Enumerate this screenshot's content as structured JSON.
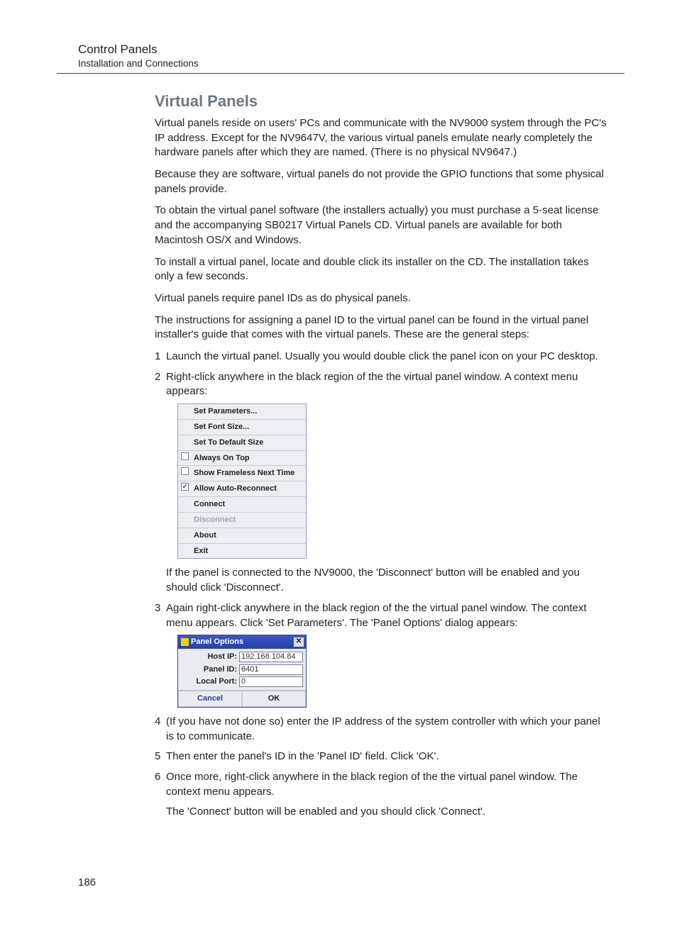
{
  "header": {
    "title": "Control Panels",
    "subtitle": "Installation and Connections"
  },
  "section_heading": "Virtual Panels",
  "paragraphs": {
    "p1": "Virtual panels reside on users' PCs and communicate with the NV9000 system through the PC's IP address. Except for the NV9647V, the various virtual panels emulate nearly completely the hardware panels after which they are named. (There is no physical NV9647.)",
    "p2": "Because they are software, virtual panels do not provide the GPIO functions that some physical panels provide.",
    "p3": "To obtain the virtual panel software (the installers actually) you must purchase a 5-seat license and the accompanying SB0217 Virtual Panels CD. Virtual panels are available for both Macintosh OS/X and Windows.",
    "p4": "To install a virtual panel, locate and double click its installer on the CD. The installation takes only a few seconds.",
    "p5": "Virtual panels require panel IDs as do physical panels.",
    "p6": "The instructions for assigning a panel ID to the virtual panel can be found in the virtual panel installer's guide that comes with the virtual panels. These are the general steps:"
  },
  "steps": {
    "s1": "Launch the virtual panel. Usually you would double click the panel icon on your PC desktop.",
    "s2": "Right-click anywhere in the black region of the the virtual panel window. A context menu appears:",
    "s2_after": "If the panel is connected to the NV9000, the 'Disconnect' button will be enabled and you should click 'Disconnect'.",
    "s3": "Again right-click anywhere in the black region of the the virtual panel window. The context menu appears. Click 'Set Parameters'. The 'Panel Options' dialog appears:",
    "s4": "(If you have not done so) enter the IP address of the system controller with which your panel is to communicate.",
    "s5": "Then enter the panel's ID in the 'Panel ID' field. Click 'OK'.",
    "s6": "Once more, right-click anywhere in the black region of the the virtual panel window. The context menu appears.",
    "s6_after": "The 'Connect' button will be enabled and you should click 'Connect'."
  },
  "context_menu": {
    "items": [
      "Set Parameters...",
      "Set Font Size...",
      "Set To Default Size",
      "Always On Top",
      "Show Frameless Next Time",
      "Allow Auto-Reconnect",
      "Connect",
      "Disconnect",
      "About",
      "Exit"
    ]
  },
  "dialog": {
    "title": "Panel Options",
    "rows": {
      "host_ip_label": "Host IP:",
      "host_ip_value": "192.168.104.84",
      "panel_id_label": "Panel ID:",
      "panel_id_value": "6401",
      "local_port_label": "Local Port:",
      "local_port_value": "0"
    },
    "buttons": {
      "cancel": "Cancel",
      "ok": "OK"
    }
  },
  "page_number": "186"
}
